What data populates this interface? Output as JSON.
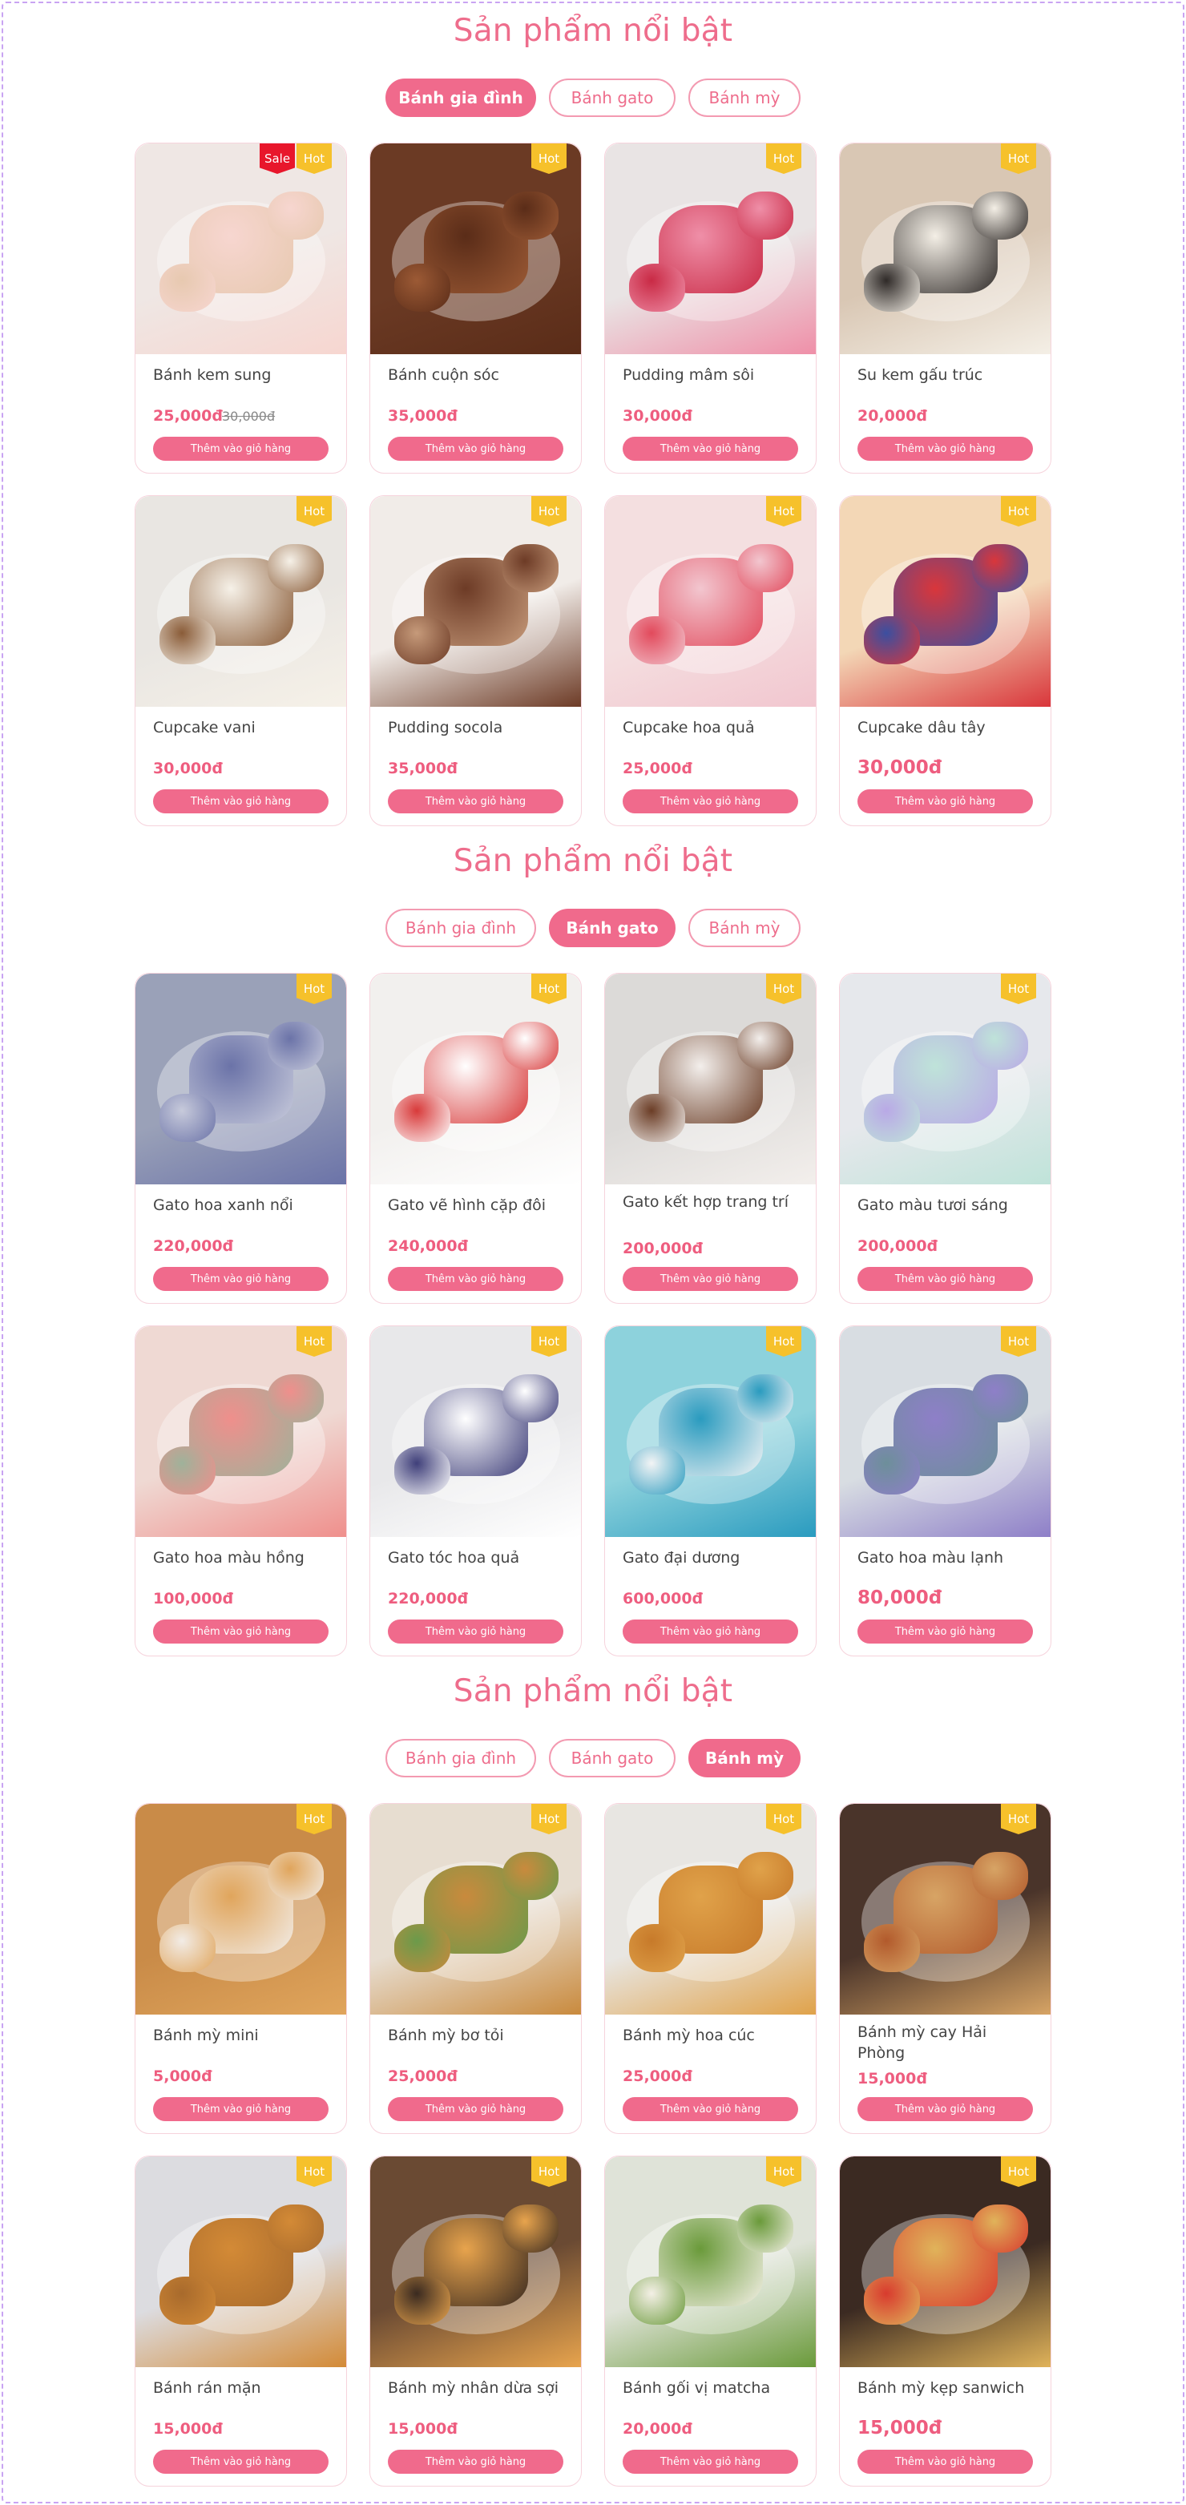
{
  "sections": [
    {
      "title": "Sản phẩm nổi bật",
      "tabs": [
        {
          "label": "Bánh gia đình",
          "active": true
        },
        {
          "label": "Bánh gato",
          "active": false
        },
        {
          "label": "Bánh mỳ",
          "active": false
        }
      ],
      "products": [
        {
          "name": "Bánh kem sung",
          "price": "25,000đ",
          "old_price": "30,000đ",
          "badges": [
            "Sale",
            "Hot"
          ],
          "colors": [
            "#efe7e4",
            "#f7d6d0",
            "#e7c9b0"
          ]
        },
        {
          "name": "Bánh cuộn sóc",
          "price": "35,000đ",
          "badges": [
            "Hot"
          ],
          "colors": [
            "#6b3a24",
            "#5a2c18",
            "#9c5a35"
          ]
        },
        {
          "name": "Pudding mâm sôi",
          "price": "30,000đ",
          "badges": [
            "Hot"
          ],
          "colors": [
            "#e9e4e4",
            "#ef8fa8",
            "#c92a45"
          ]
        },
        {
          "name": "Su kem gấu trúc",
          "price": "20,000đ",
          "badges": [
            "Hot"
          ],
          "colors": [
            "#d9c7b4",
            "#f4efe6",
            "#2f2a28"
          ]
        },
        {
          "name": "Cupcake vani",
          "price": "30,000đ",
          "badges": [
            "Hot"
          ],
          "colors": [
            "#e9e6e2",
            "#f6f1e8",
            "#8a5c38"
          ]
        },
        {
          "name": "Pudding socola",
          "price": "35,000đ",
          "badges": [
            "Hot"
          ],
          "colors": [
            "#f1ece8",
            "#6d3b26",
            "#c69a7a"
          ]
        },
        {
          "name": "Cupcake hoa quả",
          "price": "25,000đ",
          "badges": [
            "Hot"
          ],
          "colors": [
            "#f4dfe0",
            "#f2c6cf",
            "#e24a5c"
          ]
        },
        {
          "name": "Cupcake dâu tây",
          "price": "30,000đ",
          "price_big": true,
          "badges": [
            "Hot"
          ],
          "colors": [
            "#f3d7b6",
            "#d9363b",
            "#3b4fa0"
          ]
        }
      ]
    },
    {
      "title": "Sản phẩm nổi bật",
      "tabs": [
        {
          "label": "Bánh gia đình",
          "active": false
        },
        {
          "label": "Bánh gato",
          "active": true
        },
        {
          "label": "Bánh mỳ",
          "active": false
        }
      ],
      "products": [
        {
          "name": "Gato hoa xanh nổi",
          "price": "220,000đ",
          "badges": [
            "Hot"
          ],
          "colors": [
            "#9aa1b8",
            "#6b73a8",
            "#c7cadb"
          ]
        },
        {
          "name": "Gato vẽ hình cặp đôi",
          "price": "240,000đ",
          "badges": [
            "Hot"
          ],
          "colors": [
            "#f2f0ee",
            "#ffffff",
            "#d83a3a"
          ]
        },
        {
          "name": "Gato kết hợp trang trí",
          "price": "200,000đ",
          "badges": [
            "Hot"
          ],
          "colors": [
            "#dcdad8",
            "#f3efec",
            "#6b3d26"
          ]
        },
        {
          "name": "Gato màu tươi sáng",
          "price": "200,000đ",
          "badges": [
            "Hot"
          ],
          "colors": [
            "#e6e8ec",
            "#bfe3d9",
            "#b9a9e6"
          ]
        },
        {
          "name": "Gato hoa màu hồng",
          "price": "100,000đ",
          "badges": [
            "Hot"
          ],
          "colors": [
            "#efd9d3",
            "#ef8f8c",
            "#9fb29a"
          ]
        },
        {
          "name": "Gato tóc hoa quả",
          "price": "220,000đ",
          "badges": [
            "Hot"
          ],
          "colors": [
            "#e8e8ea",
            "#ffffff",
            "#3f3f7a"
          ]
        },
        {
          "name": "Gato đại dương",
          "price": "600,000đ",
          "badges": [
            "Hot"
          ],
          "colors": [
            "#8dd2dc",
            "#2a9bbf",
            "#f3f4f5"
          ]
        },
        {
          "name": "Gato hoa màu lạnh",
          "price": "80,000đ",
          "price_big": true,
          "badges": [
            "Hot"
          ],
          "colors": [
            "#d8dde2",
            "#8e7fc8",
            "#6d8f9a"
          ]
        }
      ]
    },
    {
      "title": "Sản phẩm nổi bật",
      "tabs": [
        {
          "label": "Bánh gia đình",
          "active": false
        },
        {
          "label": "Bánh gato",
          "active": false
        },
        {
          "label": "Bánh mỳ",
          "active": true
        }
      ],
      "products": [
        {
          "name": "Bánh mỳ mini",
          "price": "5,000đ",
          "badges": [
            "Hot"
          ],
          "colors": [
            "#c98b48",
            "#e0a55c",
            "#f2ece6"
          ]
        },
        {
          "name": "Bánh mỳ bơ tỏi",
          "price": "25,000đ",
          "badges": [
            "Hot"
          ],
          "colors": [
            "#e7ddd0",
            "#c98a3d",
            "#6b9a4a"
          ]
        },
        {
          "name": "Bánh mỳ hoa cúc",
          "price": "25,000đ",
          "badges": [
            "Hot"
          ],
          "colors": [
            "#e8e6e2",
            "#e0a24a",
            "#c77a2a"
          ]
        },
        {
          "name": "Bánh mỳ cay Hải Phòng",
          "price": "15,000đ",
          "badges": [
            "Hot"
          ],
          "colors": [
            "#4a342a",
            "#d7a465",
            "#b25a2c"
          ]
        },
        {
          "name": "Bánh rán mặn",
          "price": "15,000đ",
          "badges": [
            "Hot"
          ],
          "colors": [
            "#dcdce0",
            "#d38a36",
            "#a86a2c"
          ]
        },
        {
          "name": "Bánh mỳ nhân dừa sợi",
          "price": "15,000đ",
          "badges": [
            "Hot"
          ],
          "colors": [
            "#6a4a33",
            "#e8a44d",
            "#3a2a20"
          ]
        },
        {
          "name": "Bánh gối vị matcha",
          "price": "20,000đ",
          "badges": [
            "Hot"
          ],
          "colors": [
            "#dfe3d8",
            "#6a9a3a",
            "#f4f0e6"
          ]
        },
        {
          "name": "Bánh mỳ kẹp sanwich",
          "price": "15,000đ",
          "price_big": true,
          "badges": [
            "Hot"
          ],
          "colors": [
            "#3b2a22",
            "#e0b35a",
            "#d83b2e"
          ]
        }
      ]
    }
  ],
  "cart_label": "Thêm vào giỏ hàng"
}
